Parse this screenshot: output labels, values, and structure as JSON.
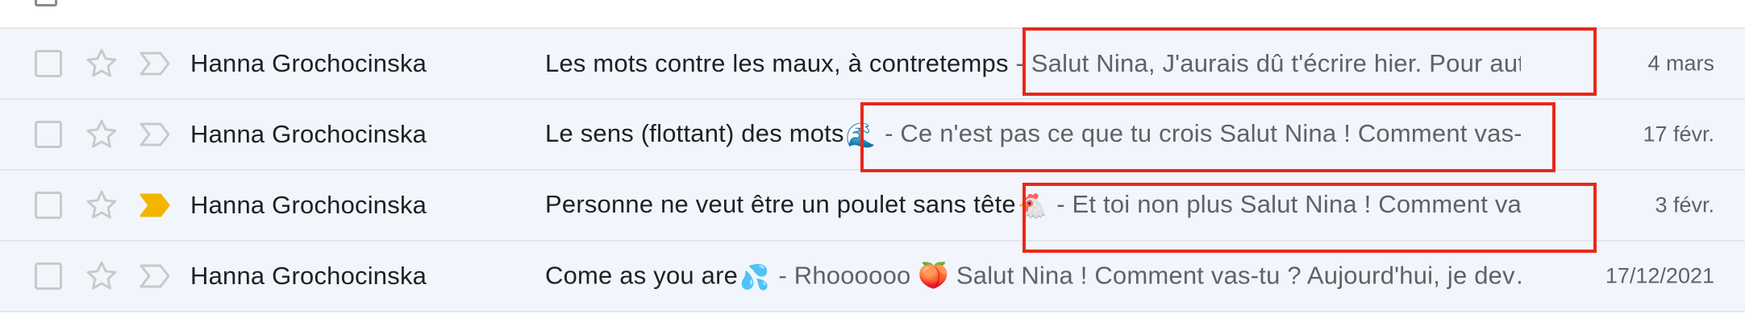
{
  "colors": {
    "row_background": "#f2f6fc",
    "highlight_border": "#e8281b",
    "important_marker_active": "#f4b400",
    "icon_grey": "#c9c9c9"
  },
  "emails": [
    {
      "sender": "Hanna Grochocinska",
      "subject": "Les mots contre les maux, à contretemps",
      "emoji": "",
      "snippet": " - Salut Nina, J'aurais dû t'écrire hier. Pour aut…",
      "date": "4 mars",
      "important": false,
      "starred": false,
      "highlighted": true
    },
    {
      "sender": "Hanna Grochocinska",
      "subject": "Le sens (flottant) des mots",
      "emoji": "🌊",
      "snippet": " - Ce n'est pas ce que tu crois Salut Nina ! Comment vas-…",
      "date": "17 févr.",
      "important": false,
      "starred": false,
      "highlighted": true
    },
    {
      "sender": "Hanna Grochocinska",
      "subject": "Personne ne veut être un poulet sans tête",
      "emoji": "🐔",
      "snippet": " - Et toi non plus Salut Nina ! Comment va…",
      "date": "3 févr.",
      "important": true,
      "starred": false,
      "highlighted": true
    },
    {
      "sender": "Hanna Grochocinska",
      "subject": "Come as you are",
      "emoji": "💦",
      "snippet": " - Rhoooooo 🍑 Salut Nina ! Comment vas-tu ? Aujourd'hui, je dev…",
      "date": "17/12/2021",
      "important": false,
      "starred": false,
      "highlighted": false
    }
  ],
  "icons": {
    "checkbox": "checkbox-icon",
    "star": "star-outline-icon",
    "important": "important-marker-icon"
  }
}
